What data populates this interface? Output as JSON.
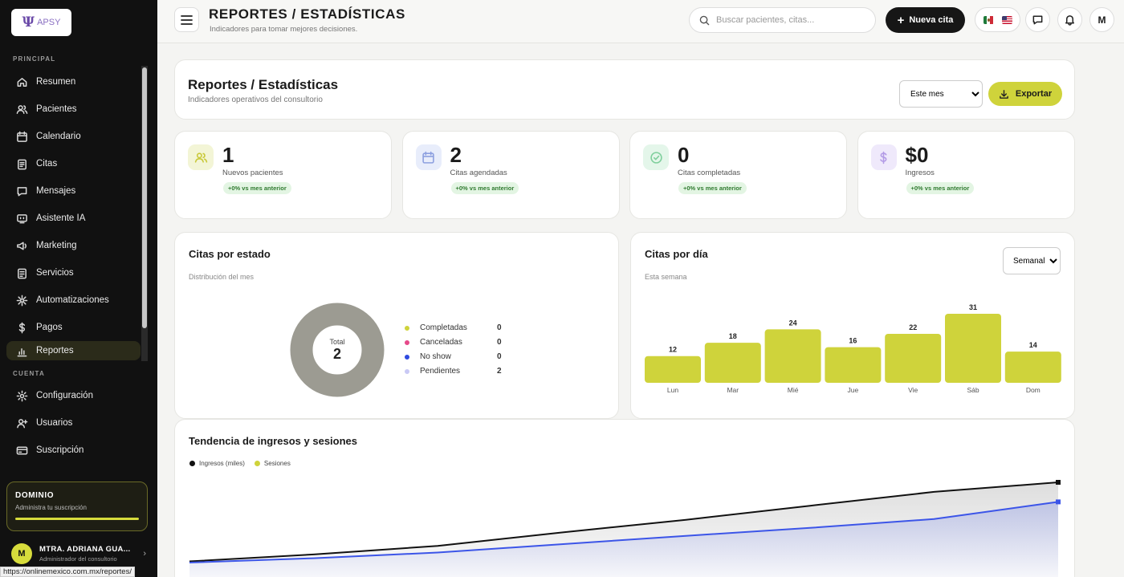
{
  "sidebar": {
    "logo_text": "APSY",
    "section_principal": "PRINCIPAL",
    "section_cuenta": "CUENTA",
    "items": [
      {
        "label": "Resumen",
        "icon": "home-icon"
      },
      {
        "label": "Pacientes",
        "icon": "users-icon"
      },
      {
        "label": "Calendario",
        "icon": "calendar-icon"
      },
      {
        "label": "Citas",
        "icon": "clipboard-icon"
      },
      {
        "label": "Mensajes",
        "icon": "message-icon"
      },
      {
        "label": "Asistente IA",
        "icon": "assistant-icon"
      },
      {
        "label": "Marketing",
        "icon": "megaphone-icon"
      },
      {
        "label": "Servicios",
        "icon": "list-icon"
      },
      {
        "label": "Automatizaciones",
        "icon": "sparkle-icon"
      },
      {
        "label": "Pagos",
        "icon": "dollar-icon"
      },
      {
        "label": "Reportes",
        "icon": "chart-icon",
        "active": true
      }
    ],
    "account_items": [
      {
        "label": "Configuración",
        "icon": "gear-icon"
      },
      {
        "label": "Usuarios",
        "icon": "user-plus-icon"
      },
      {
        "label": "Suscripción",
        "icon": "credit-card-icon"
      }
    ],
    "plan": {
      "title": "DOMINIO",
      "subtitle": "Administra tu suscripción"
    },
    "user": {
      "initial": "M",
      "name": "MTRA. ADRIANA GUA...",
      "role": "Administrador del consultorio"
    }
  },
  "status_url": "https://onlinemexico.com.mx/reportes/",
  "topbar": {
    "title": "REPORTES / ESTADÍSTICAS",
    "subtitle": "Indicadores para tomar mejores decisiones.",
    "search_placeholder": "Buscar pacientes, citas...",
    "new_button": "Nueva cita",
    "avatar_initial": "M"
  },
  "header": {
    "title": "Reportes / Estadísticas",
    "subtitle": "Indicadores operativos del consultorio",
    "period_selected": "Este mes",
    "export_label": "Exportar"
  },
  "stats": [
    {
      "value": "1",
      "label": "Nuevos pacientes",
      "delta": "+0% vs mes anterior",
      "icon": "users-icon",
      "color": "#c9c93a",
      "bg": "#f3f5d6"
    },
    {
      "value": "2",
      "label": "Citas agendadas",
      "delta": "+0% vs mes anterior",
      "icon": "calendar-icon",
      "color": "#8da0e0",
      "bg": "#e8edfb"
    },
    {
      "value": "0",
      "label": "Citas completadas",
      "delta": "+0% vs mes anterior",
      "icon": "check-circle-icon",
      "color": "#7fcf9c",
      "bg": "#e4f6ea"
    },
    {
      "value": "$0",
      "label": "Ingresos",
      "delta": "+0% vs mes anterior",
      "icon": "dollar-icon",
      "color": "#b39be6",
      "bg": "#efe9fb"
    }
  ],
  "estado": {
    "title": "Citas por estado",
    "subtitle": "Distribución del mes",
    "total_label": "Total",
    "total_value": "2",
    "items": [
      {
        "name": "Completadas",
        "count": "0",
        "color": "#cfd33b"
      },
      {
        "name": "Canceladas",
        "count": "0",
        "color": "#e64a8a"
      },
      {
        "name": "No show",
        "count": "0",
        "color": "#2f4be0"
      },
      {
        "name": "Pendientes",
        "count": "2",
        "color": "#c9c9f5"
      }
    ],
    "ring_color": "#9c9b92"
  },
  "dia": {
    "title": "Citas por día",
    "subtitle": "Esta semana",
    "range_selected": "Semanal"
  },
  "chart_data": [
    {
      "type": "bar",
      "title": "Citas por día",
      "categories": [
        "Lun",
        "Mar",
        "Mié",
        "Jue",
        "Vie",
        "Sáb",
        "Dom"
      ],
      "values": [
        12,
        18,
        24,
        16,
        22,
        31,
        14
      ],
      "color": "#cfd33b"
    },
    {
      "type": "area",
      "title": "Tendencia de ingresos y sesiones",
      "series": [
        {
          "name": "Ingresos (miles)",
          "color": "#111111",
          "values": [
            0.5,
            3.4,
            7.0,
            12.6,
            17.9,
            23.8,
            29.6,
            33.6
          ]
        },
        {
          "name": "Sesiones",
          "color": "#cfd33b",
          "values": [
            0,
            1.8,
            4.2,
            7.7,
            11.2,
            14.5,
            18.2,
            25.4
          ]
        }
      ]
    }
  ],
  "trend": {
    "title": "Tendencia de ingresos y sesiones",
    "legend": [
      "Ingresos (miles)",
      "Sesiones"
    ]
  }
}
